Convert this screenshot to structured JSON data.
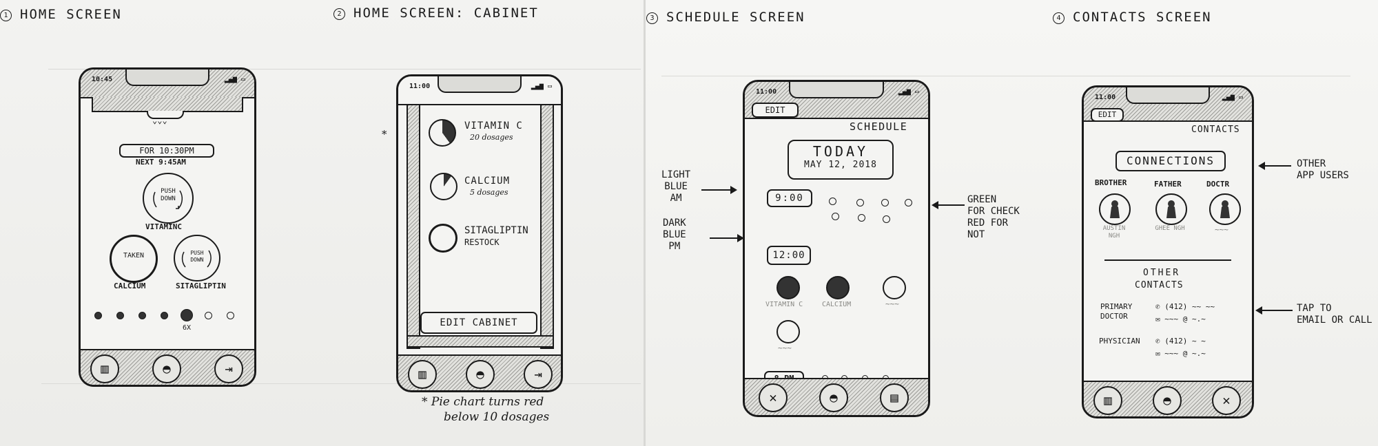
{
  "sketches": [
    {
      "number": "1",
      "title": "Home Screen"
    },
    {
      "number": "2",
      "title": "Home Screen: Cabinet"
    },
    {
      "number": "3",
      "title": "Schedule Screen"
    },
    {
      "number": "4",
      "title": "Contacts Screen"
    }
  ],
  "home": {
    "status_time": "10:45",
    "chevrons": "⌄⌄⌄",
    "for_pill": "FOR 10:30PM",
    "next_label": "NEXT 9:45AM",
    "vitamin_button": "PUSH DOWN",
    "vitamin_label": "VITAMINC",
    "calcium_button": "TAKEN",
    "calcium_label": "CALCIUM",
    "sitagliptin_button": "PUSH DOWN",
    "sitagliptin_label": "SITAGLIPTIN",
    "progress_label": "6X",
    "progress_dots_filled": 5,
    "progress_dots_total": 7
  },
  "cabinet": {
    "status_time": "11:00",
    "footnote_marker": "*",
    "items": [
      {
        "name": "VITAMIN C",
        "detail": "20 dosages"
      },
      {
        "name": "CALCIUM",
        "detail": "5 dosages"
      },
      {
        "name": "SITAGLIPTIN",
        "detail": "RESTOCK"
      }
    ],
    "edit_button": "EDIT CABINET",
    "footnote_line1": "* Pie chart turns red",
    "footnote_line2": "below 10 dosages"
  },
  "schedule": {
    "status_time": "11:00",
    "edit_button": "EDIT",
    "header_title": "SCHEDULE",
    "today_label": "TODAY",
    "date_label": "MAY 12, 2018",
    "slot_am": "9:00",
    "slot_pm": "12:00",
    "slot_night": "8 PM",
    "med_vitamin_c": "VITAMIN C",
    "med_calcium": "CALCIUM",
    "annotation_light": "LIGHT\nBLUE\nAM",
    "annotation_dark": "DARK\nBLUE\nPM",
    "annotation_green": "GREEN\nFOR CHECK\nRED FOR\nNOT"
  },
  "contacts": {
    "status_time": "11:00",
    "edit_button": "EDIT",
    "header_title": "CONTACTS",
    "connections_title": "CONNECTIONS",
    "people": [
      {
        "role": "BROTHER",
        "name": "AUSTIN NGH"
      },
      {
        "role": "FATHER",
        "name": "GHEE NGH"
      },
      {
        "role": "DOCTR",
        "name": ""
      }
    ],
    "other_contacts_line1": "OTHER",
    "other_contacts_line2": "CONTACTS",
    "primary_label": "PRIMARY\nDOCTOR",
    "primary_phone": "(412)",
    "physician_label": "PHYSICIAN",
    "physician_phone": "(412)",
    "email_suffix": "@",
    "annotation_other": "OTHER\nAPP USERS",
    "annotation_tap": "TAP TO\nEMAIL OR CALL"
  }
}
